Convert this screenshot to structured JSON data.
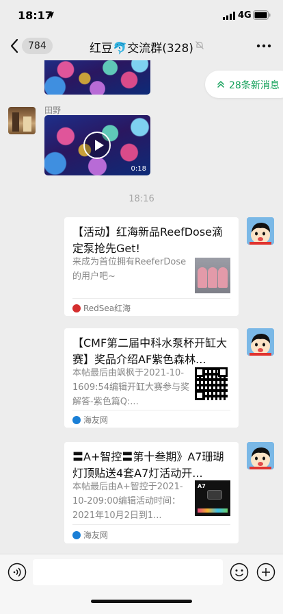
{
  "status": {
    "time": "18:17",
    "network": "4G"
  },
  "nav": {
    "unread_count": "784",
    "title": "红豆🐬交流群(328)"
  },
  "chat": {
    "prev_sender": "田野",
    "video_duration": "0:18",
    "time_divider": "18:16",
    "cards": [
      {
        "title": "【活动】红海新品ReefDose滴定泵抢先Get!",
        "desc": "来成为首位拥有ReeferDose的用户吧~",
        "source": "RedSea红海",
        "source_color": "#d42e2e"
      },
      {
        "title": "【CMF第二届中科水泵杯开缸大赛】奖品介绍AF紫色森林...",
        "desc": "本帖最后由飒枫于2021-10-1609:54编辑开缸大赛参与奖解答-紫色篇Q:...",
        "source": "海友网",
        "source_color": "#1a7fd6"
      },
      {
        "title": "〓A+智控〓第十叁期》A7珊瑚灯顶贴送4套A7灯活动开...",
        "desc": "本帖最后由A+智控于2021-10-209:00编辑活动时间：2021年10月2日到1...",
        "source": "海友网",
        "source_color": "#1a7fd6"
      }
    ]
  },
  "new_messages": {
    "label": "28条新消息",
    "color": "#13a15a"
  },
  "a7_thumb_label": "A7"
}
